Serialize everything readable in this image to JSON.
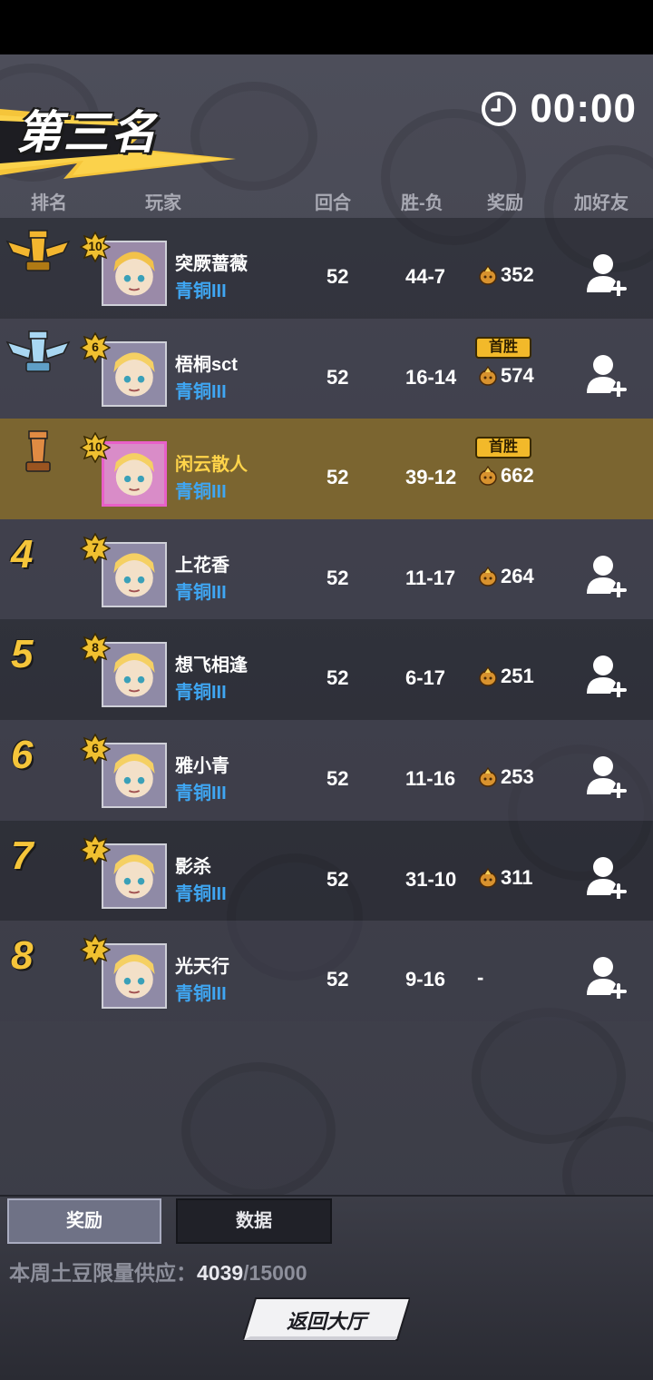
{
  "header": {
    "rank_title": "第三名",
    "timer": "00:00"
  },
  "columns": {
    "rank": "排名",
    "player": "玩家",
    "rounds": "回合",
    "record": "胜-负",
    "reward": "奖励",
    "add_friend": "加好友"
  },
  "players": [
    {
      "rank": "1",
      "medal": "gold-rook",
      "level": "10",
      "name": "突厥蔷薇",
      "tier": "青铜III",
      "rounds": "52",
      "record": "44-7",
      "reward": "352",
      "first_win": "",
      "add_friend": true,
      "me": false
    },
    {
      "rank": "2",
      "medal": "silver-rook",
      "level": "6",
      "name": "梧桐sct",
      "tier": "青铜III",
      "rounds": "52",
      "record": "16-14",
      "reward": "574",
      "first_win": "首胜",
      "add_friend": true,
      "me": false
    },
    {
      "rank": "3",
      "medal": "bronze-rook",
      "level": "10",
      "name": "闲云散人",
      "tier": "青铜III",
      "rounds": "52",
      "record": "39-12",
      "reward": "662",
      "first_win": "首胜",
      "add_friend": false,
      "me": true
    },
    {
      "rank": "4",
      "medal": "",
      "level": "7",
      "name": "上花香",
      "tier": "青铜III",
      "rounds": "52",
      "record": "11-17",
      "reward": "264",
      "first_win": "",
      "add_friend": true,
      "me": false
    },
    {
      "rank": "5",
      "medal": "",
      "level": "8",
      "name": "想飞相逢",
      "tier": "青铜III",
      "rounds": "52",
      "record": "6-17",
      "reward": "251",
      "first_win": "",
      "add_friend": true,
      "me": false
    },
    {
      "rank": "6",
      "medal": "",
      "level": "6",
      "name": "雅小青",
      "tier": "青铜III",
      "rounds": "52",
      "record": "11-16",
      "reward": "253",
      "first_win": "",
      "add_friend": true,
      "me": false
    },
    {
      "rank": "7",
      "medal": "",
      "level": "7",
      "name": "影杀",
      "tier": "青铜III",
      "rounds": "52",
      "record": "31-10",
      "reward": "311",
      "first_win": "",
      "add_friend": true,
      "me": false
    },
    {
      "rank": "8",
      "medal": "",
      "level": "7",
      "name": "光天行",
      "tier": "青铜III",
      "rounds": "52",
      "record": "9-16",
      "reward": "-",
      "first_win": "",
      "add_friend": true,
      "me": false
    }
  ],
  "tabs": {
    "rewards": "奖励",
    "data": "数据"
  },
  "supply": {
    "label": "本周土豆限量供应：",
    "current": "4039",
    "total": "/15000"
  },
  "back_button": "返回大厅",
  "colors": {
    "accent_gold": "#f5c53a",
    "tier_blue": "#3fa6f2",
    "highlight_row": "#7b6530"
  }
}
